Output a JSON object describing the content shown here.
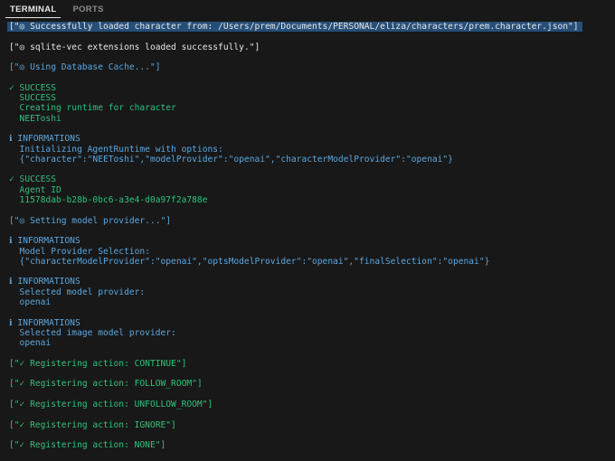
{
  "panel": {
    "tabs": [
      {
        "label": "TERMINAL",
        "active": true
      },
      {
        "label": "PORTS",
        "active": false
      }
    ]
  },
  "terminal": {
    "lines": [
      {
        "text": "[\"◎ Successfully loaded character from: /Users/prem/Documents/PERSONAL/eliza/characters/prem.character.json\"]",
        "style": "highlight"
      },
      {
        "text": "",
        "style": "gap"
      },
      {
        "text": "[\"◎ sqlite-vec extensions loaded successfully.\"]",
        "style": "white"
      },
      {
        "text": "",
        "style": "gap"
      },
      {
        "text": "[\"◎ Using Database Cache...\"]",
        "style": "blue"
      },
      {
        "text": "",
        "style": "gap"
      },
      {
        "text": "✓ SUCCESS",
        "style": "green"
      },
      {
        "text": "  SUCCESS",
        "style": "green"
      },
      {
        "text": "  Creating runtime for character",
        "style": "green"
      },
      {
        "text": "  NEEToshi",
        "style": "green"
      },
      {
        "text": "",
        "style": "gap"
      },
      {
        "text": "ℹ INFORMATIONS",
        "style": "blue"
      },
      {
        "text": "  Initializing AgentRuntime with options:",
        "style": "blue"
      },
      {
        "text": "  {\"character\":\"NEEToshi\",\"modelProvider\":\"openai\",\"characterModelProvider\":\"openai\"}",
        "style": "blue"
      },
      {
        "text": "",
        "style": "gap"
      },
      {
        "text": "✓ SUCCESS",
        "style": "green"
      },
      {
        "text": "  Agent ID",
        "style": "green"
      },
      {
        "text": "  11578dab-b28b-0bc6-a3e4-d0a97f2a788e",
        "style": "green"
      },
      {
        "text": "",
        "style": "gap"
      },
      {
        "text": "[\"◎ Setting model provider...\"]",
        "style": "blue"
      },
      {
        "text": "",
        "style": "gap"
      },
      {
        "text": "ℹ INFORMATIONS",
        "style": "blue"
      },
      {
        "text": "  Model Provider Selection:",
        "style": "blue"
      },
      {
        "text": "  {\"characterModelProvider\":\"openai\",\"optsModelProvider\":\"openai\",\"finalSelection\":\"openai\"}",
        "style": "blue"
      },
      {
        "text": "",
        "style": "gap"
      },
      {
        "text": "ℹ INFORMATIONS",
        "style": "blue"
      },
      {
        "text": "  Selected model provider:",
        "style": "blue"
      },
      {
        "text": "  openai",
        "style": "blue"
      },
      {
        "text": "",
        "style": "gap"
      },
      {
        "text": "ℹ INFORMATIONS",
        "style": "blue"
      },
      {
        "text": "  Selected image model provider:",
        "style": "blue"
      },
      {
        "text": "  openai",
        "style": "blue"
      },
      {
        "text": "",
        "style": "gap"
      },
      {
        "text": "[\"✓ Registering action: CONTINUE\"]",
        "style": "green2"
      },
      {
        "text": "",
        "style": "gap"
      },
      {
        "text": "[\"✓ Registering action: FOLLOW_ROOM\"]",
        "style": "green2"
      },
      {
        "text": "",
        "style": "gap"
      },
      {
        "text": "[\"✓ Registering action: UNFOLLOW_ROOM\"]",
        "style": "green2"
      },
      {
        "text": "",
        "style": "gap"
      },
      {
        "text": "[\"✓ Registering action: IGNORE\"]",
        "style": "green2"
      },
      {
        "text": "",
        "style": "gap"
      },
      {
        "text": "[\"✓ Registering action: NONE\"]",
        "style": "green2"
      }
    ]
  },
  "colors": {
    "background": "#181818",
    "highlight": "#264f78",
    "info_blue": "#5ba7e0",
    "success_green": "#2ec27e"
  }
}
